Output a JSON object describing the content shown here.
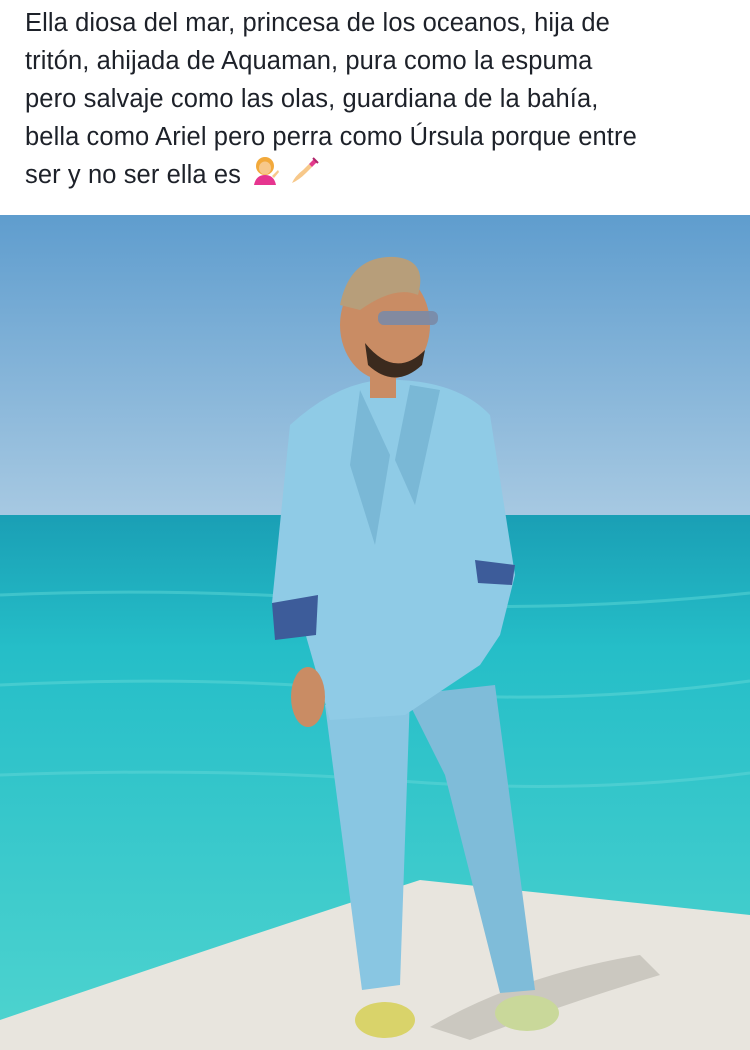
{
  "post": {
    "caption_lines": [
      "Ella diosa del mar, princesa de los oceanos, hija de",
      "tritón, ahijada de Aquaman, pura como la espuma",
      "pero salvaje como las olas, guardiana de la bahía,",
      "bella como Ariel pero perra como Úrsula porque entre",
      "ser y no ser ella es"
    ],
    "caption_emojis": [
      "person-tipping-hand-emoji",
      "nail-polish-emoji"
    ]
  },
  "colors": {
    "text": "#1d2129",
    "sky_top": "#5f9dce",
    "sky_bottom": "#a7c9e2",
    "sea_deep": "#1fb7c4",
    "sea_light": "#53d2d0",
    "suit": "#8fcbe6",
    "dock": "#e8e5de"
  }
}
